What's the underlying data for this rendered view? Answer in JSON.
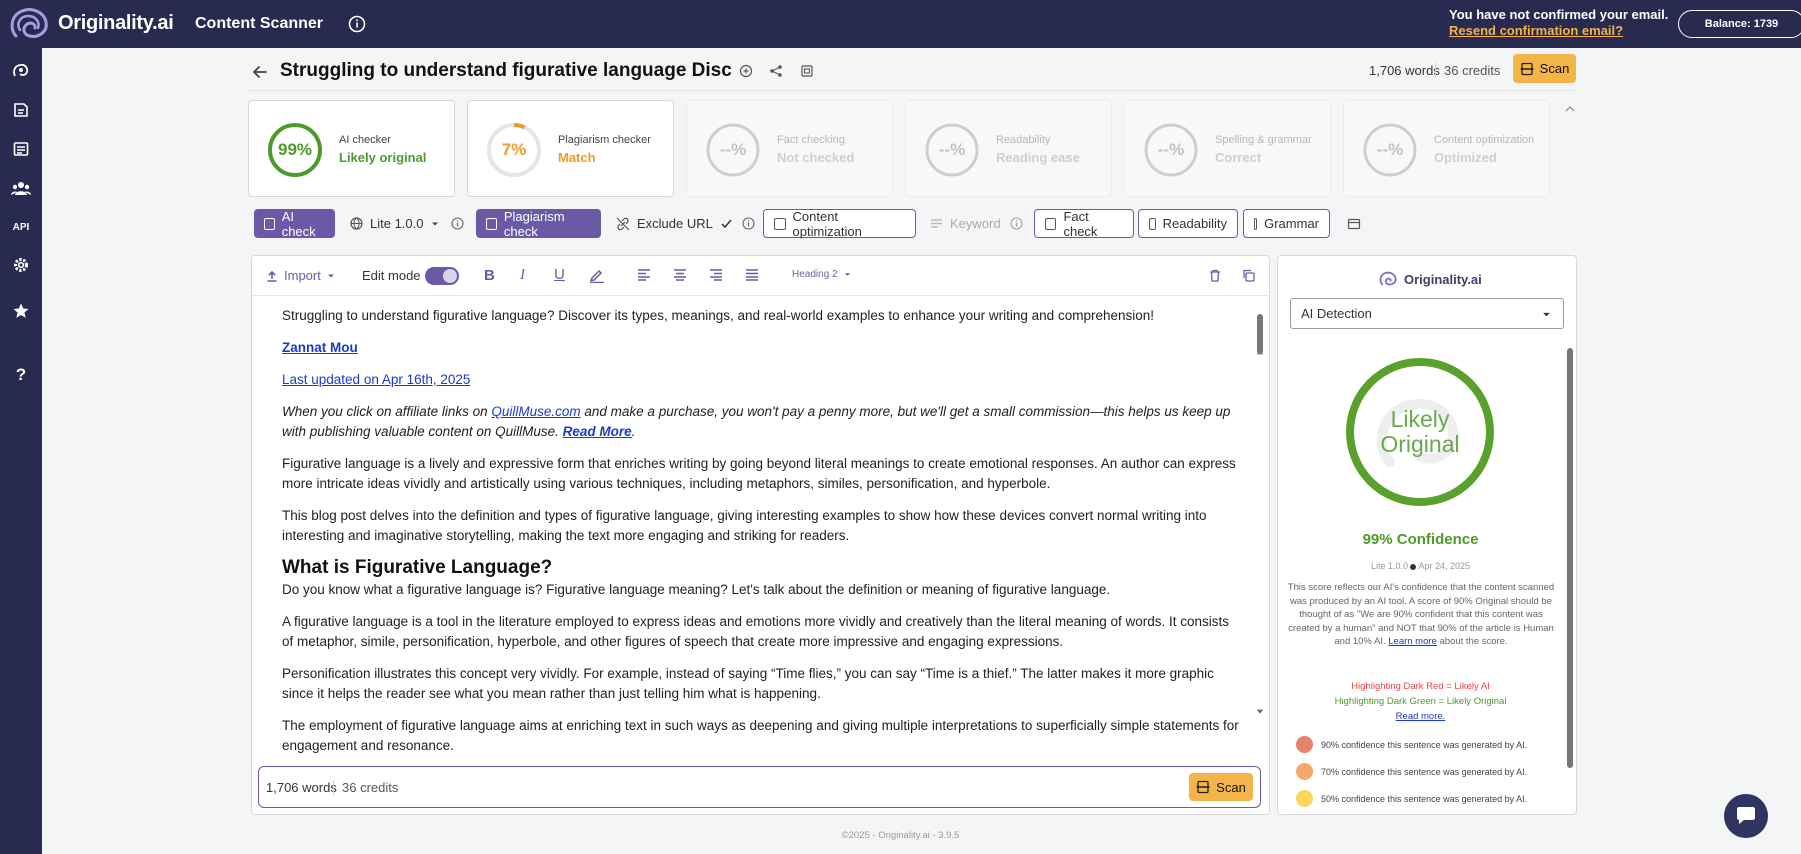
{
  "topbar": {
    "logo_text": "Originality.ai",
    "app_title": "Content Scanner",
    "email_warning": "You have not confirmed your email.",
    "resend_link": "Resend confirmation email?",
    "balance": "Balance: 1739"
  },
  "sidenav": {
    "items": [
      "ai-detector",
      "scans",
      "library",
      "team",
      "API",
      "settings",
      "favorites",
      "help"
    ],
    "api_label": "API",
    "help_label": "?"
  },
  "doc": {
    "title": "Struggling to understand figurative language Disc",
    "words": "1,706 words",
    "credits": "36 credits",
    "scan_label": "Scan"
  },
  "cards": [
    {
      "value": "99%",
      "label": "AI checker",
      "status": "Likely original",
      "color": "#4d9a2c",
      "fraction": 0.99
    },
    {
      "value": "7%",
      "label": "Plagiarism checker",
      "status": "Match",
      "color": "#f09a2c",
      "fraction": 0.07
    },
    {
      "value": "--%",
      "label": "Fact checking",
      "status": "Not checked",
      "color": "#888",
      "fraction": 0
    },
    {
      "value": "--%",
      "label": "Readability",
      "status": "Reading ease",
      "color": "#888",
      "fraction": 0
    },
    {
      "value": "--%",
      "label": "Spelling & grammar",
      "status": "Correct",
      "color": "#888",
      "fraction": 0
    },
    {
      "value": "--%",
      "label": "Content optimization",
      "status": "Optimized",
      "color": "#888",
      "fraction": 0
    }
  ],
  "toolbar": {
    "ai_check": "AI check",
    "model": "Lite 1.0.0",
    "plagiarism_check": "Plagiarism check",
    "exclude_url": "Exclude URL",
    "content_optimization": "Content optimization",
    "keyword": "Keyword",
    "fact_check": "Fact check",
    "readability": "Readability",
    "grammar": "Grammar"
  },
  "editor": {
    "import_label": "Import",
    "edit_mode_label": "Edit mode",
    "heading_select": "Heading 2",
    "p1": "Struggling to understand figurative language? Discover its types, meanings, and real-world examples to enhance your writing and comprehension!",
    "author": "Zannat Mou",
    "updated": "Last updated on Apr 16th, 2025",
    "aff_1": "When you click on affiliate links on ",
    "aff_link": "QuillMuse.com",
    "aff_2": " and make a purchase, you won't pay a penny more, but we'll get a small commission—this helps us keep up with publishing valuable content on QuillMuse. ",
    "aff_more": "Read More",
    "aff_end": ".",
    "p2": "Figurative language is a lively and expressive form that enriches writing by going beyond literal meanings to create emotional responses. An author can express more intricate ideas vividly and artistically using various techniques, including metaphors, similes, personification, and hyperbole.",
    "p3": "This blog post delves into the definition and types of figurative language, giving interesting examples to show how these devices convert normal writing into interesting and imaginative storytelling, making the text more engaging and striking for readers.",
    "h2": "What is Figurative Language?",
    "p4": "Do you know what a figurative language is? Figurative language meaning? Let's talk about the definition or meaning of figurative language.",
    "p5": "A figurative language is a tool in the literature employed to express ideas and emotions more vividly and creatively than the literal meaning of words. It consists of metaphor, simile, personification, hyperbole, and other figures of speech that create more impressive and engaging expressions.",
    "p6": "Personification illustrates this concept very vividly. For example, instead of saying “Time flies,” you can say “Time is a thief.” The latter makes it more graphic since it helps the reader see what you mean rather than just telling him what is happening.",
    "p7": "The employment of figurative language aims at enriching text in such ways as deepening and giving multiple interpretations to superficially simple statements for engagement and resonance.",
    "footer_words": "1,706 words",
    "footer_credits": "36 credits",
    "footer_scan": "Scan"
  },
  "panel": {
    "brand": "Originality.ai",
    "select": "AI Detection",
    "ring_line1": "Likely",
    "ring_line2": "Original",
    "confidence": "99% Confidence",
    "version": "Lite 1.0.0",
    "date": "Apr 24, 2025",
    "desc": "This score reflects our AI's confidence that the content scanned was produced by an AI tool. A score of 90% Original should be thought of as \"We are 90% confident that this content was created by a human\" and NOT that 90% of the article is Human and 10% AI.",
    "learn_more": "Learn more",
    "desc_end": " about the score.",
    "red_note": "Highlighting Dark Red = Likely AI",
    "green_note": "Highlighting Dark Green = Likely Original",
    "read_more": "Read more.",
    "legend": [
      {
        "text": "90% confidence this sentence was generated by AI.",
        "color": "#e8826a"
      },
      {
        "text": "70% confidence this sentence was generated by AI.",
        "color": "#f4a86a"
      },
      {
        "text": "50% confidence this sentence was generated by AI.",
        "color": "#f8d75a"
      }
    ]
  },
  "footer": "©2025 - Originality.ai - 3.9.5"
}
